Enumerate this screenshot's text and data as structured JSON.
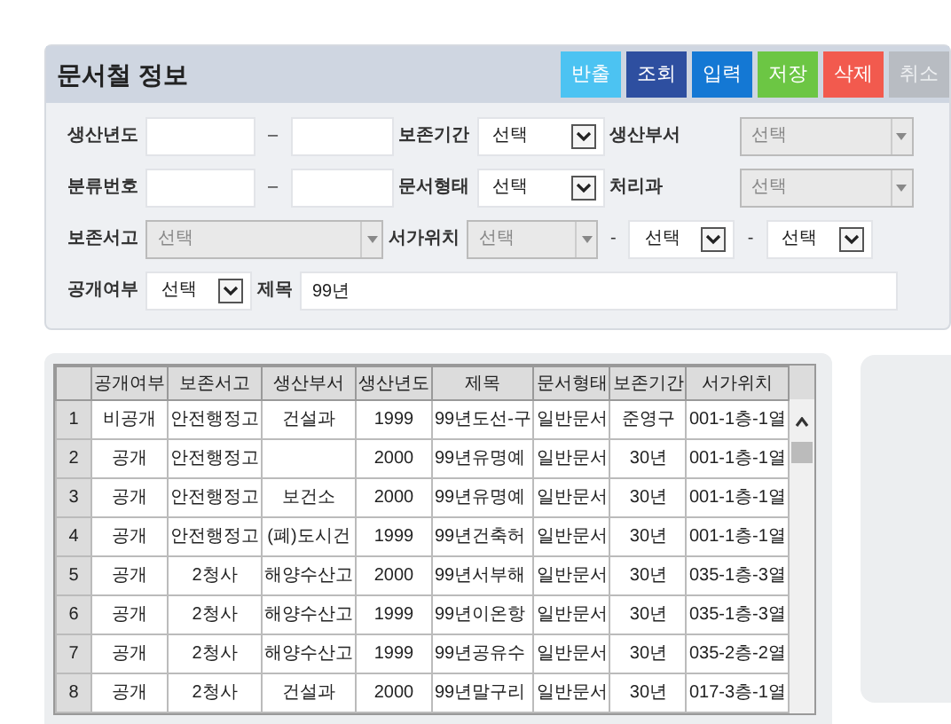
{
  "panel": {
    "title": "문서철 정보",
    "buttons": [
      {
        "label": "반출",
        "color": "#4cc3f2",
        "disabled": false
      },
      {
        "label": "조회",
        "color": "#2e4fa0",
        "disabled": false
      },
      {
        "label": "입력",
        "color": "#1478d4",
        "disabled": false
      },
      {
        "label": "저장",
        "color": "#6cc644",
        "disabled": false
      },
      {
        "label": "삭제",
        "color": "#f25a4e",
        "disabled": false
      },
      {
        "label": "취소",
        "color": "#b8bcc2",
        "disabled": true
      }
    ],
    "rows": [
      {
        "items": [
          {
            "label": "생산년도",
            "controls": [
              {
                "kind": "text"
              },
              {
                "kind": "sep",
                "text": "–"
              },
              {
                "kind": "text"
              }
            ]
          },
          {
            "label": "보존기간",
            "controls": [
              {
                "kind": "select",
                "value": "선택"
              }
            ]
          },
          {
            "label": "생산부서",
            "controls": [
              {
                "kind": "combo",
                "placeholder": "선택"
              }
            ]
          }
        ]
      },
      {
        "items": [
          {
            "label": "분류번호",
            "controls": [
              {
                "kind": "text"
              },
              {
                "kind": "sep",
                "text": "–"
              },
              {
                "kind": "text"
              }
            ]
          },
          {
            "label": "문서형태",
            "controls": [
              {
                "kind": "select",
                "value": "선택"
              }
            ]
          },
          {
            "label": "처리과",
            "controls": [
              {
                "kind": "combo",
                "placeholder": "선택"
              }
            ]
          }
        ]
      },
      {
        "items": [
          {
            "label": "보존서고",
            "controls": [
              {
                "kind": "combo",
                "placeholder": "선택"
              }
            ]
          },
          {
            "label": "서가위치",
            "controls": [
              {
                "kind": "combo",
                "placeholder": "선택"
              },
              {
                "kind": "sep",
                "text": "-"
              },
              {
                "kind": "select",
                "value": "선택"
              },
              {
                "kind": "sep",
                "text": "-"
              },
              {
                "kind": "select",
                "value": "선택"
              }
            ]
          }
        ]
      },
      {
        "items": [
          {
            "label": "공개여부",
            "controls": [
              {
                "kind": "select",
                "value": "선택"
              }
            ]
          },
          {
            "label": "제목",
            "controls": [
              {
                "kind": "text",
                "value": "99년"
              }
            ]
          }
        ]
      }
    ]
  },
  "table": {
    "columns": [
      "",
      "공개여부",
      "보존서고",
      "생산부서",
      "생산년도",
      "제목",
      "문서형태",
      "보존기간",
      "서가위치"
    ],
    "rows": [
      [
        "1",
        "비공개",
        "안전행정고",
        "건설과",
        "1999",
        "99년도선-구",
        "일반문서",
        "준영구",
        "001-1층-1열"
      ],
      [
        "2",
        "공개",
        "안전행정고",
        "",
        "2000",
        "99년유명예",
        "일반문서",
        "30년",
        "001-1층-1열"
      ],
      [
        "3",
        "공개",
        "안전행정고",
        "보건소",
        "2000",
        "99년유명예",
        "일반문서",
        "30년",
        "001-1층-1열"
      ],
      [
        "4",
        "공개",
        "안전행정고",
        "(폐)도시건",
        "1999",
        "99년건축허",
        "일반문서",
        "30년",
        "001-1층-1열"
      ],
      [
        "5",
        "공개",
        "2청사",
        "해양수산고",
        "2000",
        "99년서부해",
        "일반문서",
        "30년",
        "035-1층-3열"
      ],
      [
        "6",
        "공개",
        "2청사",
        "해양수산고",
        "1999",
        "99년이온항",
        "일반문서",
        "30년",
        "035-1층-3열"
      ],
      [
        "7",
        "공개",
        "2청사",
        "해양수산고",
        "1999",
        "99년공유수",
        "일반문서",
        "30년",
        "035-2층-2열"
      ],
      [
        "8",
        "공개",
        "2청사",
        "건설과",
        "2000",
        "99년말구리",
        "일반문서",
        "30년",
        "017-3층-1열"
      ]
    ]
  }
}
